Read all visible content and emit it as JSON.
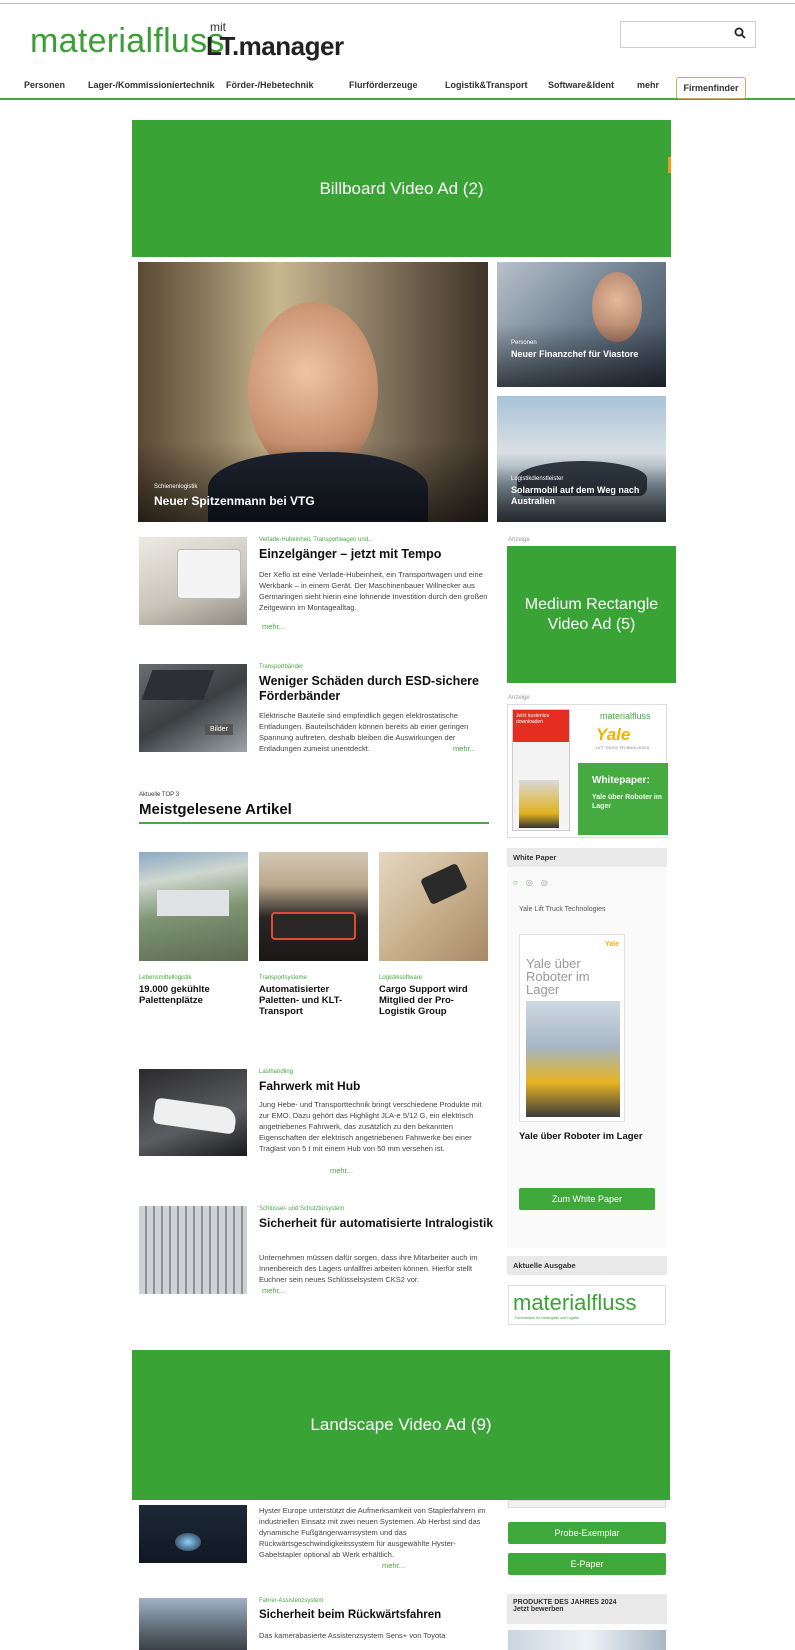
{
  "header": {
    "logo_main": "materialfluss",
    "logo_mit": "mit",
    "logo_partner": "LT.manager",
    "search_placeholder": ""
  },
  "nav": {
    "items": [
      "Personen",
      "Lager-/Kommissioniertechnik",
      "Förder-/Hebetechnik",
      "Flurförderzeuge",
      "Logistik&Transport",
      "Software&Ident",
      "mehr"
    ],
    "firmenfinder": "Firmenfinder"
  },
  "ads": {
    "billboard": "Billboard Video Ad (2)",
    "medium_rectangle": "Medium Rectangle Video Ad (5)",
    "landscape": "Landscape Video Ad (9)"
  },
  "hero": {
    "kicker": "Schienenlogistik",
    "title": "Neuer Spitzenmann bei VTG"
  },
  "side_teasers": [
    {
      "kicker": "Personen",
      "title": "Neuer Finanzchef für Viastore"
    },
    {
      "kicker": "Logistikdienstleister",
      "title": "Solarmobil auf dem Weg nach Australien"
    }
  ],
  "articles": [
    {
      "kicker": "Verlade-Hubeinheit, Transportwagen und...",
      "title": "Einzelgänger – jetzt mit Tempo",
      "body": "Der Xeflo ist eine Verlade-Hubeinheit, ein Transportwagen und eine Werkbank – in einem Gerät. Der Maschinenbauer Willnecker aus Germaringen sieht hierin eine lohnende Investition durch den großen Zeitgewinn im Montagealltag.",
      "more": "mehr..."
    },
    {
      "kicker": "Transportbänder",
      "title": "Weniger Schäden durch ESD-sichere Förderbänder",
      "body": "Elektrische Bauteile sind empfindlich gegen elektrostatische Entladungen. Bauteilschäden können bereits ab einer geringen Spannung auftreten, deshalb bleiben die Auswirkungen der Entladungen zumeist unentdeckt.",
      "more": "mehr...",
      "badge": "Bilder"
    }
  ],
  "top3": {
    "kicker": "Aktuelle TOP 3",
    "heading": "Meistgelesene Artikel",
    "items": [
      {
        "kicker": "Lebensmittellogistik",
        "title": "19.000 gekühlte Palettenplätze"
      },
      {
        "kicker": "Transportsysteme",
        "title": "Automatisierter Paletten- und KLT-Transport"
      },
      {
        "kicker": "Logistiksoftware",
        "title": "Cargo Support wird Mitglied der Pro-Logistik Group"
      }
    ]
  },
  "articles2": [
    {
      "kicker": "Lasthandling",
      "title": "Fahrwerk mit Hub",
      "body": "Jung Hebe- und Transporttechnik bringt verschiedene Produkte mit zur EMO. Dazu gehört das Highlight JLA-e 5/12 G, ein elektrisch angetriebenes Fahrwerk, das zusätzlich zu den bekannten Eigenschaften der elektrisch angetriebenen Fahrwerke bei einer Traglast von 5 t mit einem Hub von 50 mm versehen ist.",
      "more": "mehr..."
    },
    {
      "kicker": "Schlüssel- und Schutztürsystem",
      "title": "Sicherheit für automatisierte Intralogistik",
      "body": "Unternehmen müssen dafür sorgen, dass ihre Mitarbeiter auch im Innenbereich des Lagers unfallfrei arbeiten können. Hierfür stellt Euchner sein neues Schlüsselsystem CKS2 vor.",
      "more": "mehr..."
    },
    {
      "kicker": "",
      "title": "",
      "body": "Hyster Europe unterstützt die Aufmerksamkeit von Staplerfahrern im industriellen Einsatz mit zwei neuen Systemen. Ab Herbst sind das dynamische Fußgängerwarnsystem und das Rückwärtsgeschwindigkeitssystem für ausgewählte Hyster-Gabelstapler optional ab Werk erhältlich.",
      "more": "mehr..."
    },
    {
      "kicker": "Fahrer-Assistenzsystem",
      "title": "Sicherheit beim Rückwärtsfahren",
      "body": "Das kamerabasierte Assistenzsystem Sens+ von Toyota",
      "more": ""
    }
  ],
  "sidebar": {
    "anzeige": "Anzeige",
    "wp_ad": {
      "badge": "Jetzt kostenlos downloaden",
      "brand": "materialfluss",
      "logo": "Yale",
      "logo_sub": "LIFT TRUCK TECHNOLOGIES",
      "title": "Whitepaper:",
      "subtitle": "Yale über Roboter im Lager"
    },
    "white_paper": {
      "heading": "White Paper",
      "company": "Yale Lift Truck Technologies",
      "cover_title": "Yale über Roboter im Lager",
      "title": "Yale über Roboter im Lager",
      "button": "Zum White Paper"
    },
    "ausgabe": {
      "heading": "Aktuelle Ausgabe",
      "mag_title": "materialfluss",
      "mag_sub": "Fachmedium für Intralogistik und Logistik"
    },
    "probe": "Probe-Exemplar",
    "epaper": "E-Paper",
    "produkte": {
      "line1": "PRODUKTE DES JAHRES 2024",
      "line2": "Jetzt bewerben"
    }
  },
  "colors": {
    "brand_green": "#3aa336",
    "accent_green": "#4aa545"
  }
}
